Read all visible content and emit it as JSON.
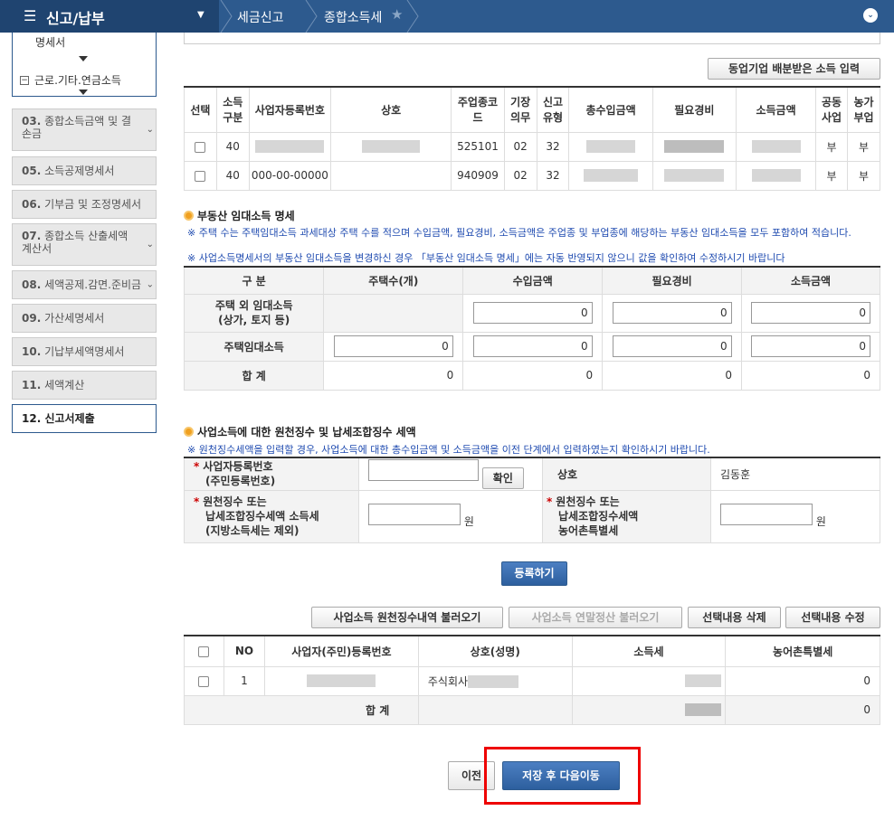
{
  "header": {
    "menu_title": "신고/납부",
    "breadcrumb": [
      "세금신고",
      "종합소득세"
    ]
  },
  "sidebar": {
    "top_text": "명세서",
    "sub_item": "근로.기타.연금소득",
    "items": [
      {
        "num": "03.",
        "label": "종합소득금액 및 결손금"
      },
      {
        "num": "05.",
        "label": "소득공제명세서"
      },
      {
        "num": "06.",
        "label": "기부금 및 조정명세서"
      },
      {
        "num": "07.",
        "label": "종합소득 산출세액계산서"
      },
      {
        "num": "08.",
        "label": "세액공제.감면.준비금"
      },
      {
        "num": "09.",
        "label": "가산세명세서"
      },
      {
        "num": "10.",
        "label": "기납부세액명세서"
      },
      {
        "num": "11.",
        "label": "세액계산"
      },
      {
        "num": "12.",
        "label": "신고서제출"
      }
    ]
  },
  "coop_button": "동업기업 배분받은 소득 입력",
  "business_table": {
    "headers": [
      "선택",
      "소득구분",
      "사업자등록번호",
      "상호",
      "주업종코드",
      "기장의무",
      "신고유형",
      "총수입금액",
      "필요경비",
      "소득금액",
      "공동사업",
      "농가부업"
    ],
    "rows": [
      {
        "type": "40",
        "regno": "",
        "code": "525101",
        "duty": "02",
        "report": "32",
        "joint": "부",
        "farm": "부"
      },
      {
        "type": "40",
        "regno": "000-00-00000",
        "code": "940909",
        "duty": "02",
        "report": "32",
        "joint": "부",
        "farm": "부"
      }
    ]
  },
  "real_estate": {
    "title": "부동산 임대소득 명세",
    "notes": [
      "※ 주택 수는 주택임대소득 과세대상 주택 수를 적으며 수입금액, 필요경비, 소득금액은 주업종 및 부업종에 해당하는 부동산 임대소득을 모두 포함하여 적습니다.",
      "※ 사업소득명세서의 부동산 임대소득을 변경하신 경우 「부동산 임대소득 명세」에는 자동 반영되지 않으니 값을 확인하여 수정하시기 바랍니다"
    ],
    "headers": [
      "구 분",
      "주택수(개)",
      "수입금액",
      "필요경비",
      "소득금액"
    ],
    "row1_label": "주택 외 임대소득\n(상가, 토지 등)",
    "row2_label": "주택임대소득",
    "total_label": "합 계",
    "row1_values": [
      "0",
      "0",
      "0"
    ],
    "row2_values": [
      "0",
      "0",
      "0",
      "0"
    ],
    "total_values": [
      "0",
      "0",
      "0",
      "0"
    ]
  },
  "withholding": {
    "title": "사업소득에 대한 원천징수 및 납세조합징수 세액",
    "note": "※ 원천징수세액을 입력할 경우, 사업소득에 대한 총수입금액 및 소득금액을 이전 단계에서 입력하였는지 확인하시기 바랍니다.",
    "regno_label_1": "사업자등록번호",
    "regno_label_2": "(주민등록번호)",
    "confirm_button": "확인",
    "company_label": "상호",
    "company_value": "김동훈",
    "tax_label_1": "원천징수 또는",
    "tax_label_2": "납세조합징수세액 소득세",
    "tax_label_3": "(지방소득세는 제외)",
    "unit": "원",
    "rural_label_1": "원천징수 또는",
    "rural_label_2": "납세조합징수세액",
    "rural_label_3": "농어촌특별세",
    "register_button": "등록하기"
  },
  "action_buttons": [
    "사업소득 원천징수내역 불러오기",
    "사업소득 연말정산 불러오기",
    "선택내용 삭제",
    "선택내용 수정"
  ],
  "list_table": {
    "headers": [
      "NO",
      "사업자(주민)등록번호",
      "상호(성명)",
      "소득세",
      "농어촌특별세"
    ],
    "rows": [
      {
        "no": "1",
        "name": "주식회사",
        "rural": "0"
      }
    ],
    "total_label": "합 계",
    "total_rural": "0"
  },
  "footer": {
    "prev_button": "이전",
    "save_button": "저장 후 다음이동"
  }
}
